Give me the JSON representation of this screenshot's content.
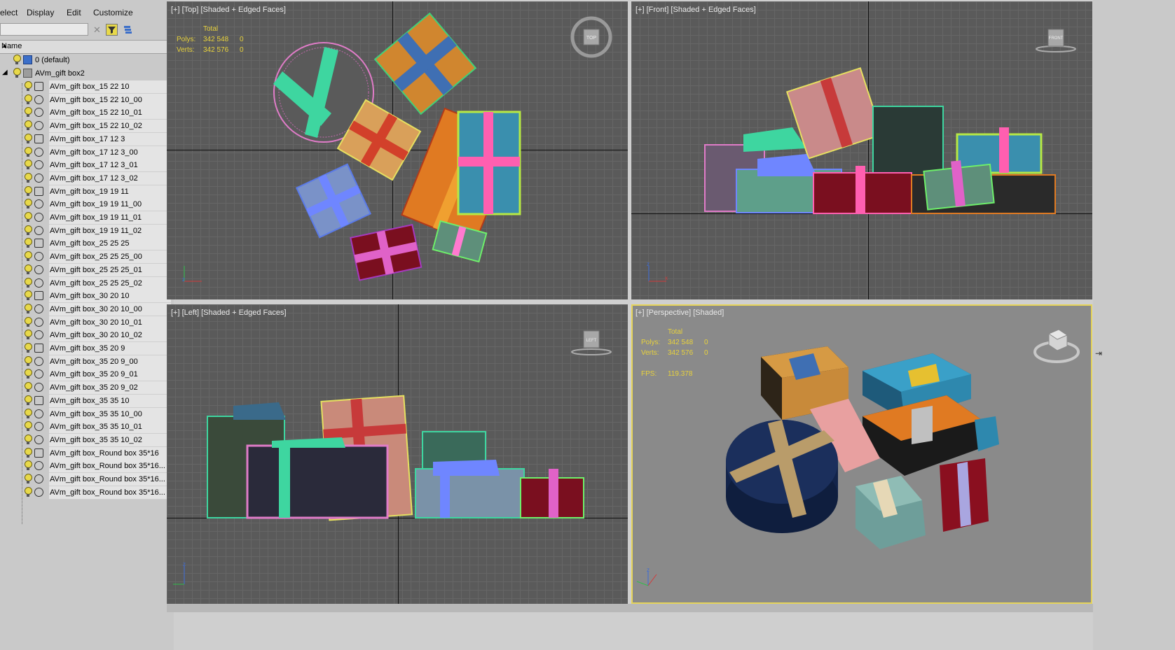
{
  "menubar": {
    "items": [
      "elect",
      "Display",
      "Edit",
      "Customize"
    ]
  },
  "toolbar": {
    "search_value": "",
    "buttons": [
      "clear-icon",
      "filter-icon",
      "layers-icon"
    ]
  },
  "list_header": {
    "column": "Name"
  },
  "layers": {
    "default": "0 (default)",
    "group": "AVm_gift box2"
  },
  "objects": [
    "AVm_gift box_15 22 10",
    "AVm_gift box_15 22 10_00",
    "AVm_gift box_15 22 10_01",
    "AVm_gift box_15 22 10_02",
    "AVm_gift box_17 12 3",
    "AVm_gift box_17 12 3_00",
    "AVm_gift box_17 12 3_01",
    "AVm_gift box_17 12 3_02",
    "AVm_gift box_19 19 11",
    "AVm_gift box_19 19 11_00",
    "AVm_gift box_19 19 11_01",
    "AVm_gift box_19 19 11_02",
    "AVm_gift box_25 25 25",
    "AVm_gift box_25 25 25_00",
    "AVm_gift box_25 25 25_01",
    "AVm_gift box_25 25 25_02",
    "AVm_gift box_30 20 10",
    "AVm_gift box_30 20 10_00",
    "AVm_gift box_30 20 10_01",
    "AVm_gift box_30 20 10_02",
    "AVm_gift box_35 20 9",
    "AVm_gift box_35 20 9_00",
    "AVm_gift box_35 20 9_01",
    "AVm_gift box_35 20 9_02",
    "AVm_gift box_35 35 10",
    "AVm_gift box_35 35 10_00",
    "AVm_gift box_35 35 10_01",
    "AVm_gift box_35 35 10_02",
    "AVm_gift box_Round box 35*16",
    "AVm_gift box_Round box 35*16...",
    "AVm_gift box_Round box 35*16...",
    "AVm_gift box_Round box 35*16..."
  ],
  "viewports": {
    "top": {
      "label": "[+] [Top] [Shaded + Edged Faces]",
      "total": "Total",
      "polys_label": "Polys:",
      "polys_value": "342 548",
      "polys_sel": "0",
      "verts_label": "Verts:",
      "verts_value": "342 576",
      "verts_sel": "0",
      "cube": "TOP"
    },
    "front": {
      "label": "[+] [Front] [Shaded + Edged Faces]",
      "cube": "FRONT"
    },
    "left": {
      "label": "[+] [Left] [Shaded + Edged Faces]",
      "cube": "LEFT"
    },
    "perspective": {
      "label": "[+] [Perspective] [Shaded]",
      "total": "Total",
      "polys_label": "Polys:",
      "polys_value": "342 548",
      "polys_sel": "0",
      "verts_label": "Verts:",
      "verts_value": "342 576",
      "verts_sel": "0",
      "fps_label": "FPS:",
      "fps_value": "119.378"
    }
  },
  "colors": {
    "panel_bg": "#c9c9c9",
    "viewport_bg": "#5a5a5a",
    "active_border": "#e6d45a",
    "stats_text": "#e8d23c"
  }
}
